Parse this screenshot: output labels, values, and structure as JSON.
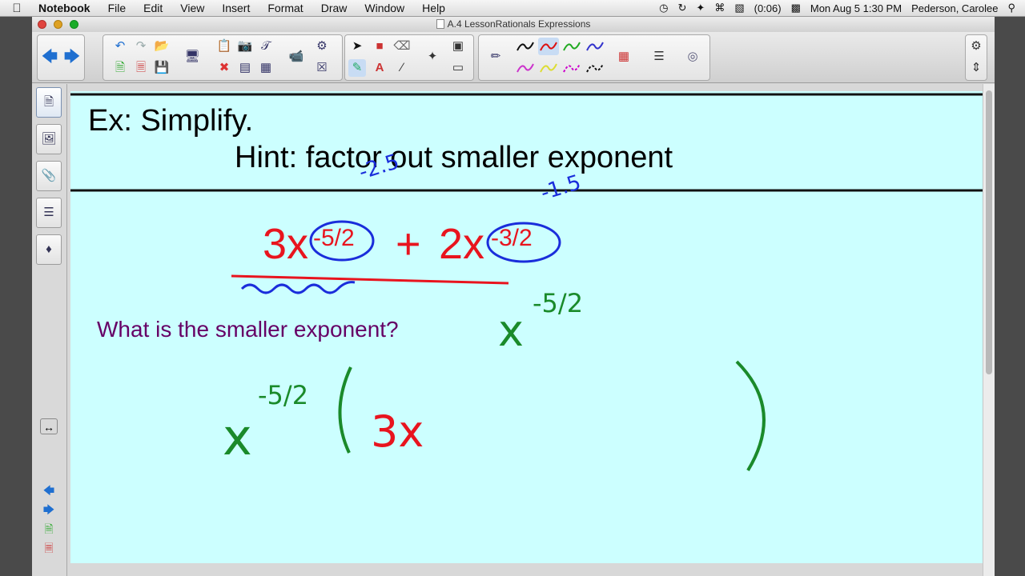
{
  "menubar": {
    "app": "Notebook",
    "items": [
      "File",
      "Edit",
      "View",
      "Insert",
      "Format",
      "Draw",
      "Window",
      "Help"
    ],
    "battery": "(0:06)",
    "datetime": "Mon Aug 5  1:30 PM",
    "user": "Pederson, Carolee"
  },
  "window": {
    "title": "A.4 LessonRationals Expressions"
  },
  "icons": {
    "apple": "apple-logo-icon",
    "search": "spotlight-search-icon",
    "settings": "gear-icon"
  },
  "canvas": {
    "background": "#ccffff",
    "title": "Ex: Simplify.",
    "hint": "Hint:  factor out smaller exponent",
    "question": "What is the smaller exponent?",
    "expression": {
      "term1_coef": "3x",
      "term1_exp": "-5/2",
      "operator": "+",
      "term2_coef": "2x",
      "term2_exp": "-3/2"
    },
    "annotations": {
      "decimal1": "-2.5",
      "decimal2": "-1.5",
      "answer_base": "x",
      "answer_exp": "-5/2",
      "factored_base": "x",
      "factored_exp": "-5/2",
      "factored_inner": "3x"
    }
  },
  "colors": {
    "red": "#e8141e",
    "blue": "#1a2ddb",
    "green": "#1a8a2a",
    "purple": "#660066"
  }
}
